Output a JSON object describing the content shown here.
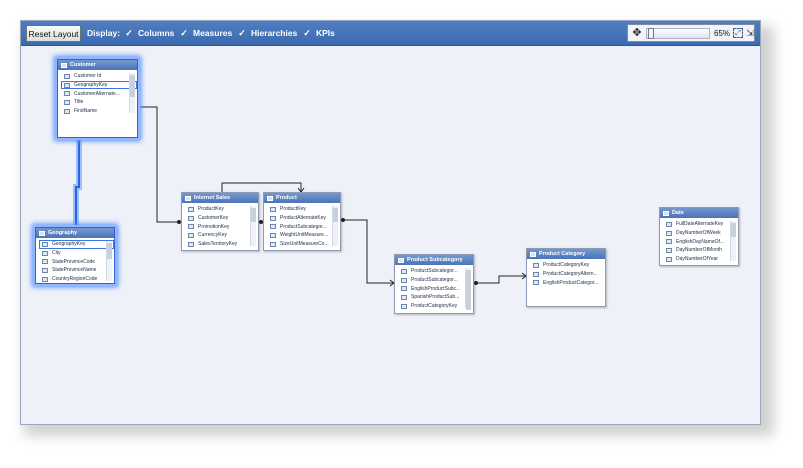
{
  "toolbar": {
    "reset_label": "Reset Layout",
    "display_label": "Display:",
    "toggles": [
      {
        "label": "Columns",
        "checked": true
      },
      {
        "label": "Measures",
        "checked": true
      },
      {
        "label": "Hierarchies",
        "checked": true
      },
      {
        "label": "KPIs",
        "checked": true
      }
    ],
    "zoom": {
      "value": "65%",
      "level": 0.65
    }
  },
  "tables": [
    {
      "name": "Customer",
      "selected": true,
      "columns": [
        "Customer Id",
        "GeographyKey",
        "CustomerAlternate...",
        "Title",
        "FirstName"
      ],
      "highlighted": "GeographyKey"
    },
    {
      "name": "Geography",
      "selected": true,
      "columns": [
        "GeographyKey",
        "City",
        "StateProvinceCode",
        "StateProvinceName",
        "CountryRegionCode"
      ],
      "highlighted": "GeographyKey"
    },
    {
      "name": "Internet Sales",
      "selected": false,
      "columns": [
        "ProductKey",
        "CustomerKey",
        "PromotionKey",
        "CurrencyKey",
        "SalesTerritoryKey"
      ]
    },
    {
      "name": "Product",
      "selected": false,
      "columns": [
        "ProductKey",
        "ProductAlternateKey",
        "ProductSubcategor...",
        "WeightUnitMeasure...",
        "SizeUnitMeasureCo..."
      ]
    },
    {
      "name": "Product Subcategory",
      "selected": false,
      "columns": [
        "ProductSubcategor...",
        "ProductSubcategor...",
        "EnglishProductSubc...",
        "SpanishProductSub...",
        "ProductCategoryKey"
      ]
    },
    {
      "name": "Product Category",
      "selected": false,
      "columns": [
        "ProductCategoryKey",
        "ProductCategoryAltern...",
        "EnglishProductCategor..."
      ]
    },
    {
      "name": "Date",
      "selected": false,
      "columns": [
        "FullDateAlternateKey",
        "DayNumberOfWeek",
        "EnglishDayNameOf...",
        "DayNumberOfMonth",
        "DayNumberOfYear"
      ]
    }
  ],
  "colors": {
    "toolbar": "#3c6ab0",
    "canvas": "#eef1f8",
    "selection_glow": "#4f8bff",
    "relationship_line": "#222222"
  }
}
